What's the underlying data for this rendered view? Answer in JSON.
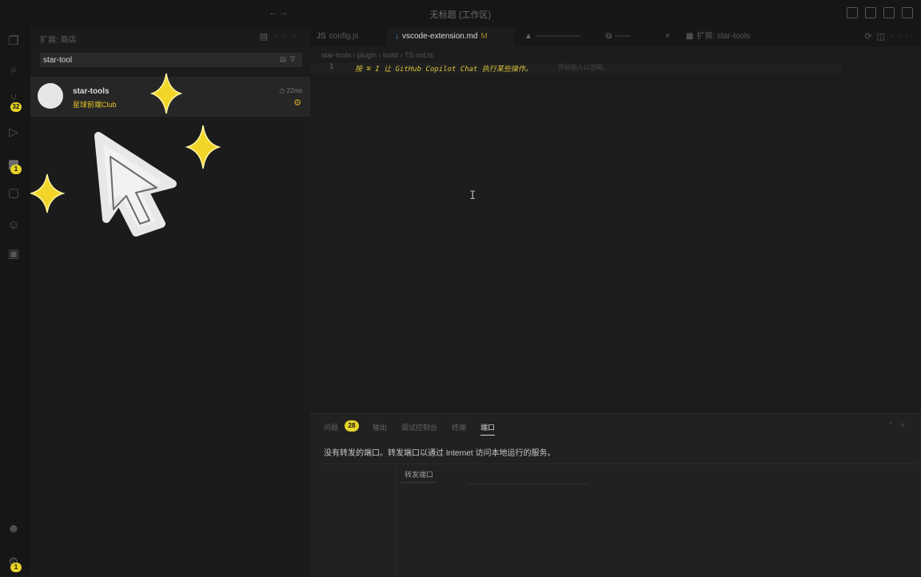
{
  "window": {
    "title": "无标题 (工作区)"
  },
  "activity_bar": {
    "items": [
      {
        "name": "explorer-icon",
        "glyph": "❐"
      },
      {
        "name": "search-icon",
        "glyph": "⌕"
      },
      {
        "name": "source-control-icon",
        "glyph": "⑂",
        "badge": "32"
      },
      {
        "name": "run-debug-icon",
        "glyph": "▷"
      },
      {
        "name": "extensions-icon",
        "glyph": "▦",
        "badge": "1"
      },
      {
        "name": "remote-explorer-icon",
        "glyph": "▢"
      },
      {
        "name": "copilot-icon",
        "glyph": "☺"
      },
      {
        "name": "chat-icon",
        "glyph": "▣"
      }
    ],
    "bottom": [
      {
        "name": "account-icon",
        "glyph": "☻"
      },
      {
        "name": "manage-gear-icon",
        "glyph": "⚙",
        "badge": "1"
      }
    ]
  },
  "sidebar": {
    "title": "扩展: 商店",
    "search": {
      "value": "star-tool",
      "placeholder": ""
    },
    "result": {
      "name": "star-tools",
      "publisher": "星球前端Club",
      "installed_ago": "22ms"
    }
  },
  "editor": {
    "tabs": [
      {
        "label": "config.js",
        "icon": "JS",
        "active": false
      },
      {
        "label": "vscode-extension.md",
        "icon": "↓",
        "modified": "M",
        "active": true
      },
      {
        "label": "",
        "icon": "▲",
        "active": false
      },
      {
        "label": "",
        "icon": "⧉",
        "active": false,
        "closable": true
      },
      {
        "label": "扩展: star-tools",
        "icon": "▦",
        "active": false
      }
    ],
    "breadcrumb": "star-tools › plugin › build › TS md.ts",
    "line_number": "1",
    "code": "按 ⌘ I 让 GitHub Copilot Chat 执行某些操作。",
    "ghost_hint": "开始输入以忽略。"
  },
  "panel": {
    "tabs": [
      {
        "label": "问题",
        "active": false
      },
      {
        "label": "输出",
        "active": false
      },
      {
        "label": "调试控制台",
        "active": false
      },
      {
        "label": "终端",
        "active": false
      },
      {
        "label": "端口",
        "active": true
      }
    ],
    "problems_count": "28",
    "ports_message": "没有转发的端口。转发端口以通过 Internet 访问本地运行的服务。",
    "forward_button": "转发端口"
  },
  "colors": {
    "accent": "#e5d229",
    "background": "#1a1a1a"
  }
}
